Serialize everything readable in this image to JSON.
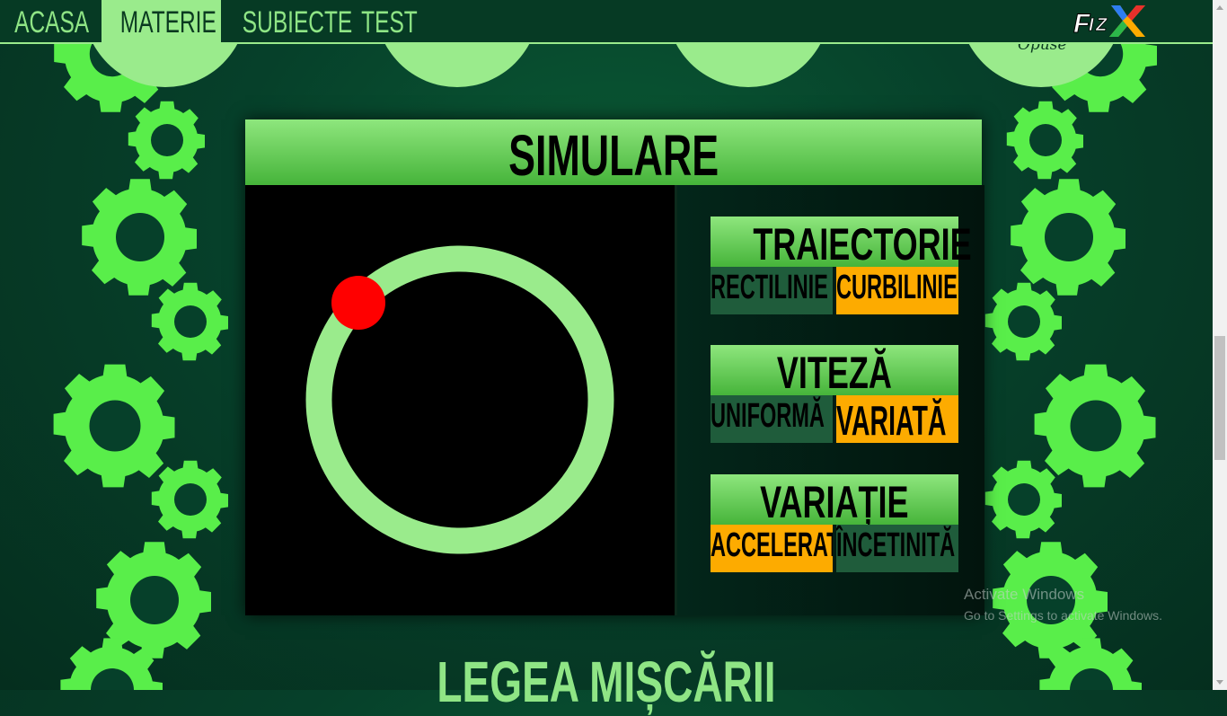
{
  "nav": {
    "items": [
      {
        "label": "ACASA",
        "active": false
      },
      {
        "label": "MATERIE",
        "active": true
      },
      {
        "label": "SUBIECTE",
        "active": false
      },
      {
        "label": "TEST",
        "active": false
      }
    ],
    "logo_text": "FIZX"
  },
  "top_circles": {
    "partial_caption": "Opuse"
  },
  "simulation": {
    "title": "SIMULARE",
    "groups": [
      {
        "title": "TRAIECTORIE",
        "options": [
          {
            "label": "RECTILINIE",
            "selected": false
          },
          {
            "label": "CURBILINIE",
            "selected": true
          }
        ]
      },
      {
        "title": "VITEZĂ",
        "options": [
          {
            "label": "UNIFORMĂ",
            "selected": false
          },
          {
            "label": "VARIATĂ",
            "selected": true
          }
        ]
      },
      {
        "title": "VARIAȚIE",
        "options": [
          {
            "label": "ACCELERATĂ",
            "selected": true
          },
          {
            "label": "ÎNCETINITĂ",
            "selected": false
          }
        ]
      }
    ]
  },
  "section_heading": "LEGEA MIȘCĂRII",
  "watermark": {
    "line1": "Activate Windows",
    "line2": "Go to Settings to activate Windows."
  },
  "colors": {
    "accent_green": "#9aeb8c",
    "selected_orange": "#fdab00",
    "unselected_green": "#1f5c3b",
    "ball_red": "#ff0000"
  }
}
